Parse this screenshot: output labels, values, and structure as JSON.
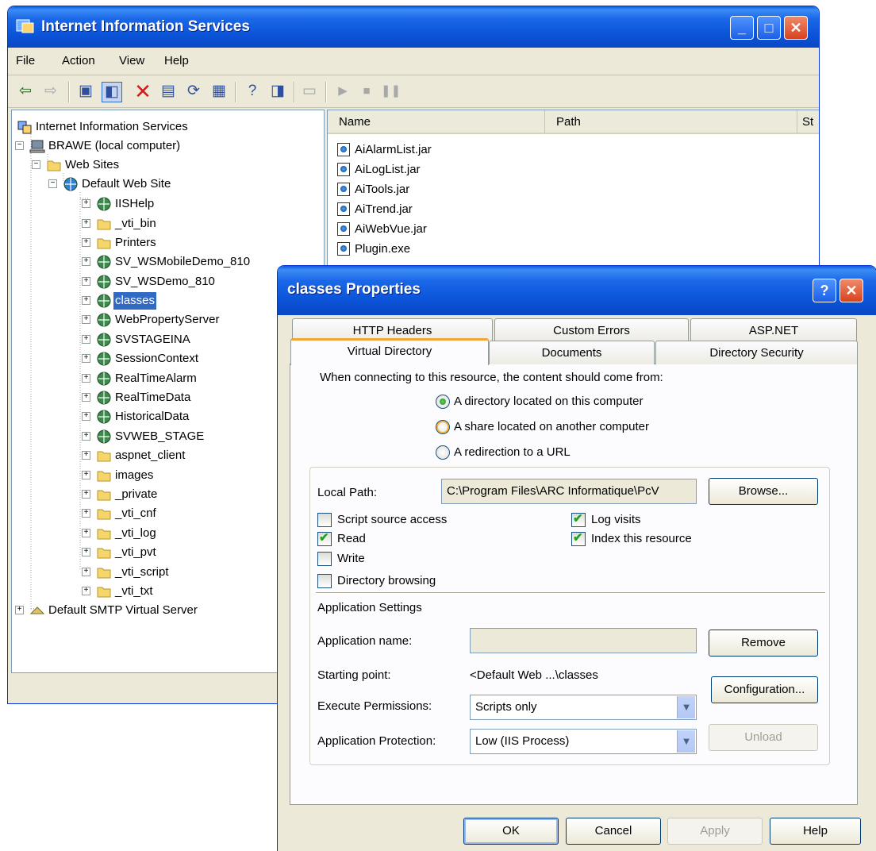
{
  "iis_window": {
    "title": "Internet Information Services",
    "menu": [
      "File",
      "Action",
      "View",
      "Help"
    ],
    "list_columns": [
      "Name",
      "Path",
      "St"
    ],
    "tree": [
      {
        "label": "Internet Information Services",
        "icon": "iis-root-icon"
      },
      {
        "label": "BRAWE (local computer)",
        "icon": "computer-icon"
      },
      {
        "label": "Web Sites",
        "icon": "folder-icon"
      },
      {
        "label": "Default Web Site",
        "icon": "web-site-icon"
      },
      {
        "label": "IISHelp",
        "icon": "virtual-dir-icon"
      },
      {
        "label": "_vti_bin",
        "icon": "folder-icon"
      },
      {
        "label": "Printers",
        "icon": "folder-icon"
      },
      {
        "label": "SV_WSMobileDemo_810",
        "icon": "virtual-dir-icon"
      },
      {
        "label": "SV_WSDemo_810",
        "icon": "virtual-dir-icon"
      },
      {
        "label": "classes",
        "icon": "virtual-dir-icon"
      },
      {
        "label": "WebPropertyServer",
        "icon": "virtual-dir-icon"
      },
      {
        "label": "SVSTAGEINA",
        "icon": "virtual-dir-icon"
      },
      {
        "label": "SessionContext",
        "icon": "virtual-dir-icon"
      },
      {
        "label": "RealTimeAlarm",
        "icon": "virtual-dir-icon"
      },
      {
        "label": "RealTimeData",
        "icon": "virtual-dir-icon"
      },
      {
        "label": "HistoricalData",
        "icon": "virtual-dir-icon"
      },
      {
        "label": "SVWEB_STAGE",
        "icon": "virtual-dir-icon"
      },
      {
        "label": "aspnet_client",
        "icon": "folder-icon"
      },
      {
        "label": "images",
        "icon": "folder-icon"
      },
      {
        "label": "_private",
        "icon": "folder-icon"
      },
      {
        "label": "_vti_cnf",
        "icon": "folder-icon"
      },
      {
        "label": "_vti_log",
        "icon": "folder-icon"
      },
      {
        "label": "_vti_pvt",
        "icon": "folder-icon"
      },
      {
        "label": "_vti_script",
        "icon": "folder-icon"
      },
      {
        "label": "_vti_txt",
        "icon": "folder-icon"
      },
      {
        "label": "Default SMTP Virtual Server",
        "icon": "smtp-server-icon"
      }
    ],
    "files": [
      "AiAlarmList.jar",
      "AiLogList.jar",
      "AiTools.jar",
      "AiTrend.jar",
      "AiWebVue.jar",
      "Plugin.exe"
    ]
  },
  "dialog": {
    "title": "classes Properties",
    "tabs_back": [
      "HTTP Headers",
      "Custom Errors",
      "ASP.NET"
    ],
    "tabs_front": [
      "Virtual Directory",
      "Documents",
      "Directory Security"
    ],
    "active_tab": "Virtual Directory",
    "connect_prompt": "When connecting to this resource, the content should come from:",
    "radios": [
      "A directory located on this computer",
      "A share located on another computer",
      "A redirection to a URL"
    ],
    "local_path_label": "Local Path:",
    "local_path_value": "C:\\Program Files\\ARC Informatique\\PcV",
    "browse_label": "Browse...",
    "checkboxes": {
      "script_source": {
        "label": "Script source access",
        "checked": false
      },
      "read": {
        "label": "Read",
        "checked": true
      },
      "write": {
        "label": "Write",
        "checked": false
      },
      "dir_browsing": {
        "label": "Directory browsing",
        "checked": false
      },
      "log_visits": {
        "label": "Log visits",
        "checked": true
      },
      "index_resource": {
        "label": "Index this resource",
        "checked": true
      }
    },
    "app_settings_heading": "Application Settings",
    "app_name_label": "Application name:",
    "app_name_value": "",
    "remove_label": "Remove",
    "starting_point_label": "Starting point:",
    "starting_point_value": "<Default Web ...\\classes",
    "configuration_label": "Configuration...",
    "exec_perm_label": "Execute Permissions:",
    "exec_perm_value": "Scripts only",
    "app_protection_label": "Application Protection:",
    "app_protection_value": "Low (IIS Process)",
    "unload_label": "Unload",
    "buttons": {
      "ok": "OK",
      "cancel": "Cancel",
      "apply": "Apply",
      "help": "Help"
    }
  },
  "colors": {
    "xp_blue": "#0a5ce0",
    "selection": "#316ac5",
    "dialog_bg": "#ece9d8"
  }
}
